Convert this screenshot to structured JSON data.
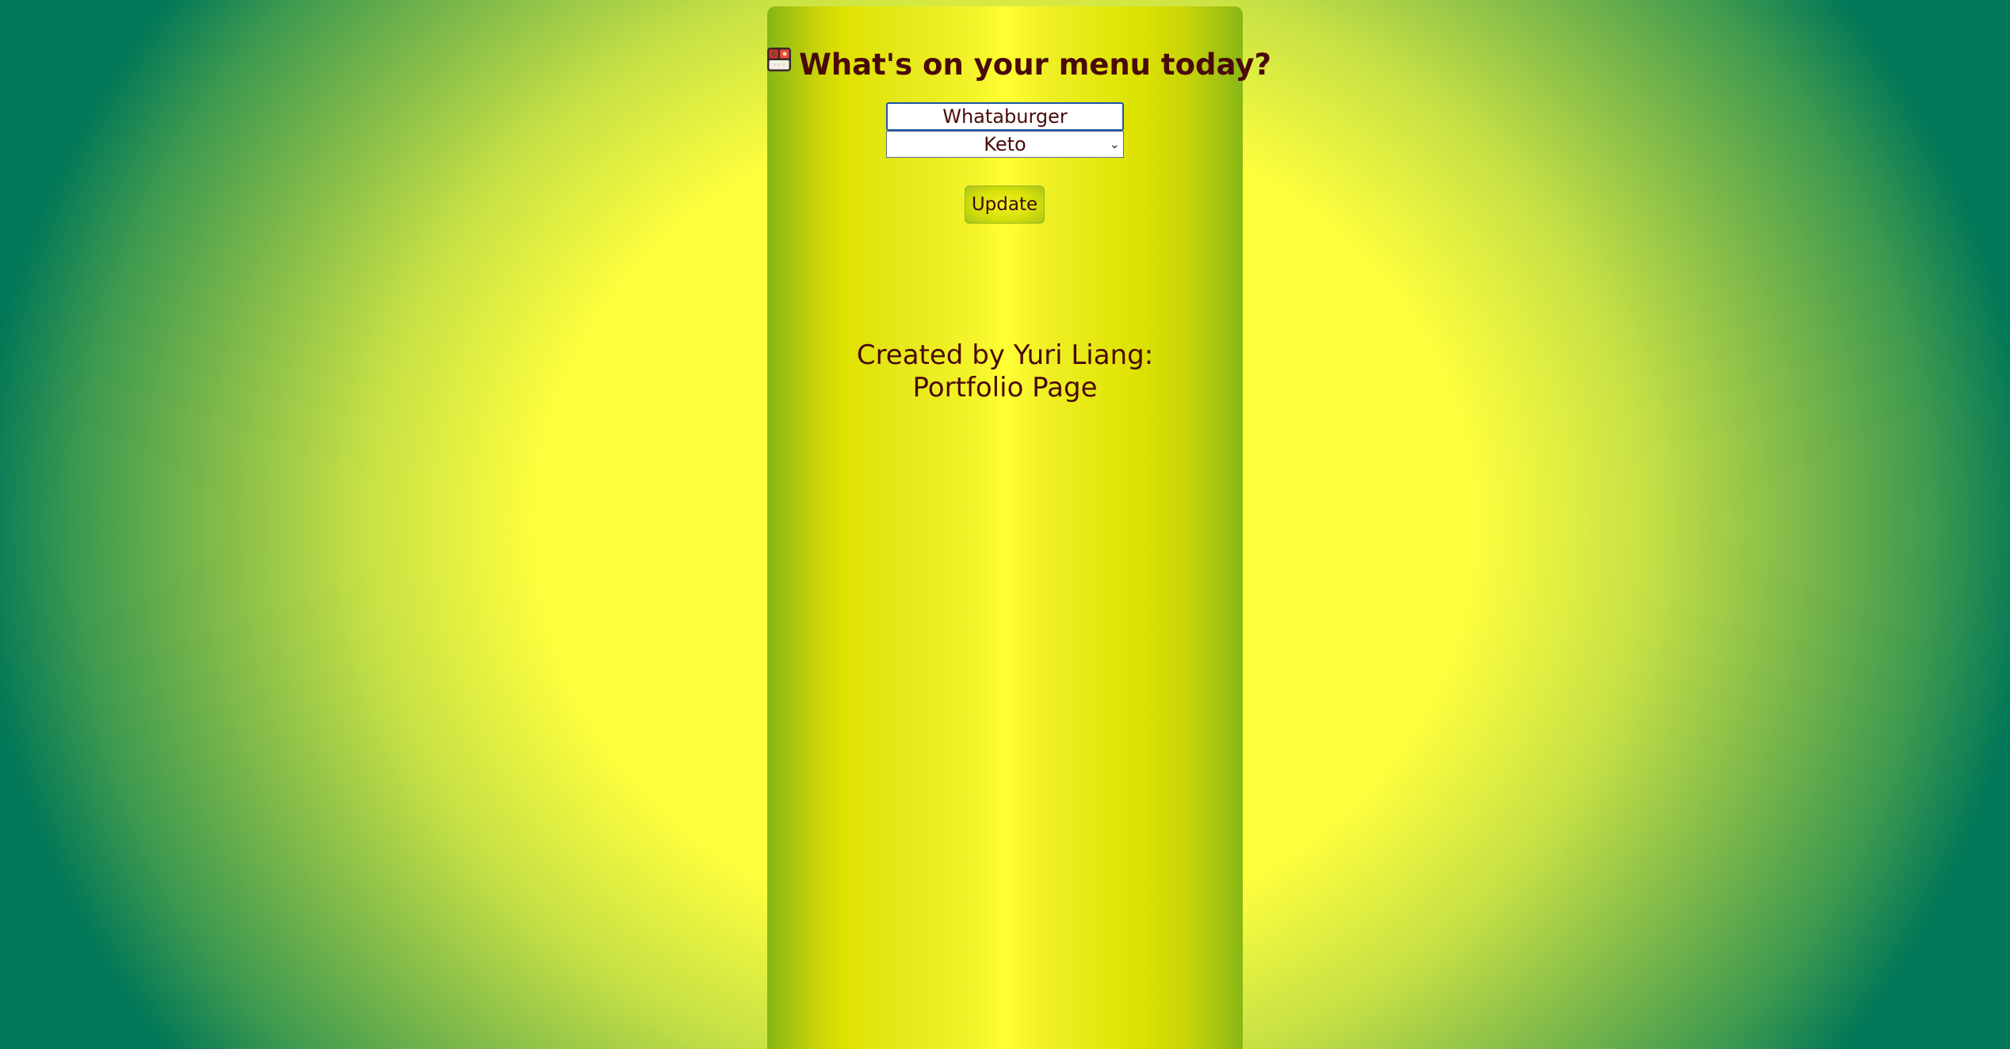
{
  "header": {
    "title": "What's on your menu today?",
    "icon": "bento-box-icon"
  },
  "form": {
    "restaurant_value": "Whataburger",
    "diet_selected": "Keto",
    "update_label": "Update"
  },
  "footer": {
    "credit_prefix": "Created by Yuri Liang:",
    "portfolio_link": "Portfolio Page"
  },
  "colors": {
    "text": "#4a0a0a",
    "background_center": "#ffff3c",
    "background_edge": "#007758"
  }
}
